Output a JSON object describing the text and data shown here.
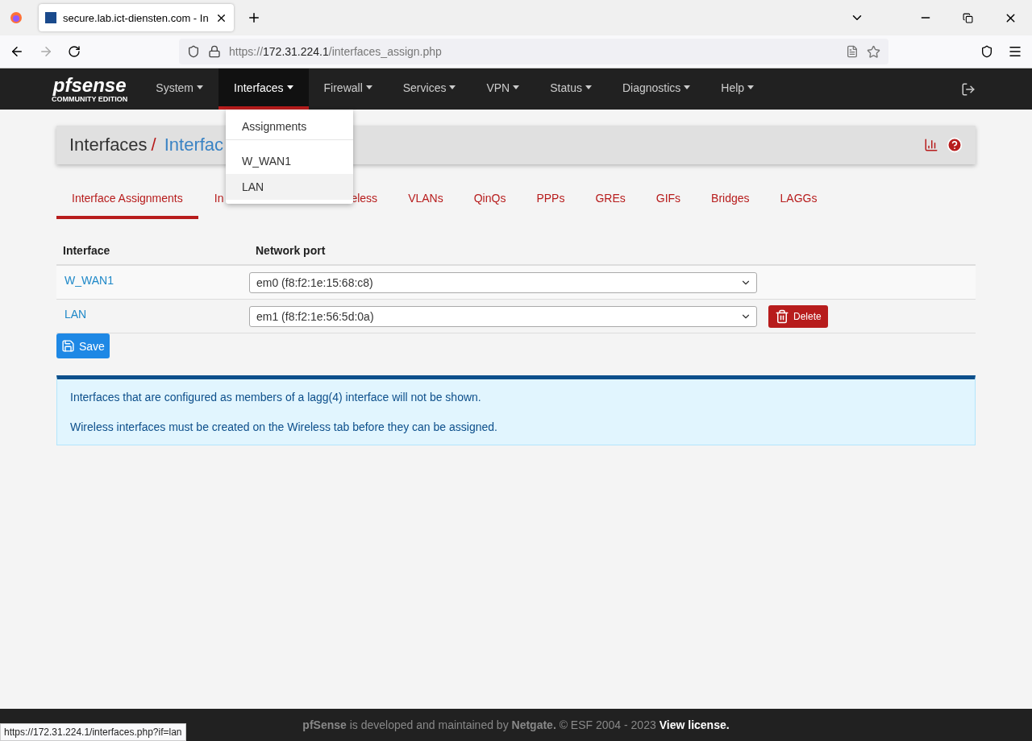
{
  "browser": {
    "tab_title": "secure.lab.ict-diensten.com - In",
    "url_prefix": "https://",
    "url_host": "172.31.224.1",
    "url_path": "/interfaces_assign.php"
  },
  "logo": {
    "name": "pfsense",
    "edition": "COMMUNITY EDITION"
  },
  "nav": [
    {
      "label": "System",
      "selected": false
    },
    {
      "label": "Interfaces",
      "selected": true
    },
    {
      "label": "Firewall",
      "selected": false
    },
    {
      "label": "Services",
      "selected": false
    },
    {
      "label": "VPN",
      "selected": false
    },
    {
      "label": "Status",
      "selected": false
    },
    {
      "label": "Diagnostics",
      "selected": false
    },
    {
      "label": "Help",
      "selected": false
    }
  ],
  "dropdown": [
    {
      "label": "Assignments",
      "selected": false,
      "divider_after": true
    },
    {
      "label": "W_WAN1",
      "selected": false,
      "divider_after": false
    },
    {
      "label": "LAN",
      "selected": true,
      "divider_after": false
    }
  ],
  "breadcrumb": {
    "section": "Interfaces",
    "separator": "/",
    "page": "Interfac"
  },
  "tabs": [
    {
      "label": "Interface Assignments",
      "selected": true
    },
    {
      "label": "In",
      "selected": false
    },
    {
      "label": "eless",
      "selected": false
    },
    {
      "label": "VLANs",
      "selected": false
    },
    {
      "label": "QinQs",
      "selected": false
    },
    {
      "label": "PPPs",
      "selected": false
    },
    {
      "label": "GREs",
      "selected": false
    },
    {
      "label": "GIFs",
      "selected": false
    },
    {
      "label": "Bridges",
      "selected": false
    },
    {
      "label": "LAGGs",
      "selected": false
    }
  ],
  "table": {
    "columns": [
      "Interface",
      "Network port"
    ],
    "rows": [
      {
        "interface": "W_WAN1",
        "port": "em0 (f8:f2:1e:15:68:c8)",
        "deletable": false
      },
      {
        "interface": "LAN",
        "port": "em1 (f8:f2:1e:56:5d:0a)",
        "deletable": true
      }
    ]
  },
  "delete_label": "Delete",
  "save_label": "Save",
  "info": [
    "Interfaces that are configured as members of a lagg(4) interface will not be shown.",
    "Wireless interfaces must be created on the Wireless tab before they can be assigned."
  ],
  "footer": {
    "text": "**pfSense** is developed and maintained by **Netgate.** © ESF 2004 - 2023",
    "link": "View license."
  },
  "status_url": "https://172.31.224.1/interfaces.php?if=lan"
}
